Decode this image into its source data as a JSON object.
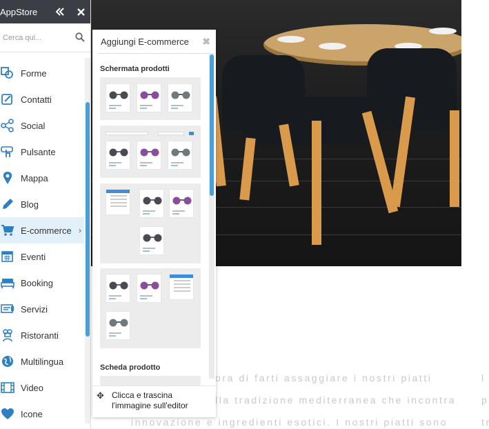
{
  "sidebar": {
    "title": "AppStore",
    "search_placeholder": "Cerca qui...",
    "items": [
      {
        "label": "Forme",
        "icon": "shapes-icon"
      },
      {
        "label": "Contatti",
        "icon": "contact-form-icon"
      },
      {
        "label": "Social",
        "icon": "share-icon"
      },
      {
        "label": "Pulsante",
        "icon": "pointer-button-icon"
      },
      {
        "label": "Mappa",
        "icon": "map-pin-icon"
      },
      {
        "label": "Blog",
        "icon": "pencil-icon"
      },
      {
        "label": "E-commerce",
        "icon": "cart-icon",
        "active": true
      },
      {
        "label": "Eventi",
        "icon": "calendar-icon"
      },
      {
        "label": "Booking",
        "icon": "bed-icon"
      },
      {
        "label": "Servizi",
        "icon": "services-icon"
      },
      {
        "label": "Ristoranti",
        "icon": "chef-icon"
      },
      {
        "label": "Multilingua",
        "icon": "globe-icon"
      },
      {
        "label": "Video",
        "icon": "film-icon"
      },
      {
        "label": "Icone",
        "icon": "heart-icon"
      }
    ],
    "active_chevron": "›"
  },
  "panel": {
    "title": "Aggiungi E-commerce",
    "close_glyph": "✖",
    "section_products": "Schermata prodotti",
    "section_product_card": "Scheda prodotto",
    "footer_text": "Clicca e trascina\nl'immagine sull'editor",
    "move_glyph": "✥"
  },
  "page": {
    "body_lines": [
      "ora di farti assaggiare i nostri piatti",
      "lla tradizione mediterranea che incontra",
      "innovazione e ingredienti esotici. I nostri piatti sono"
    ],
    "right_column_lines": [
      "l",
      "p",
      "tr"
    ]
  },
  "colors": {
    "accent": "#4a9fd4",
    "header_bg": "#3b3f45",
    "active_bg": "#e2f1f9",
    "icon_blue": "#2f7fc1"
  }
}
